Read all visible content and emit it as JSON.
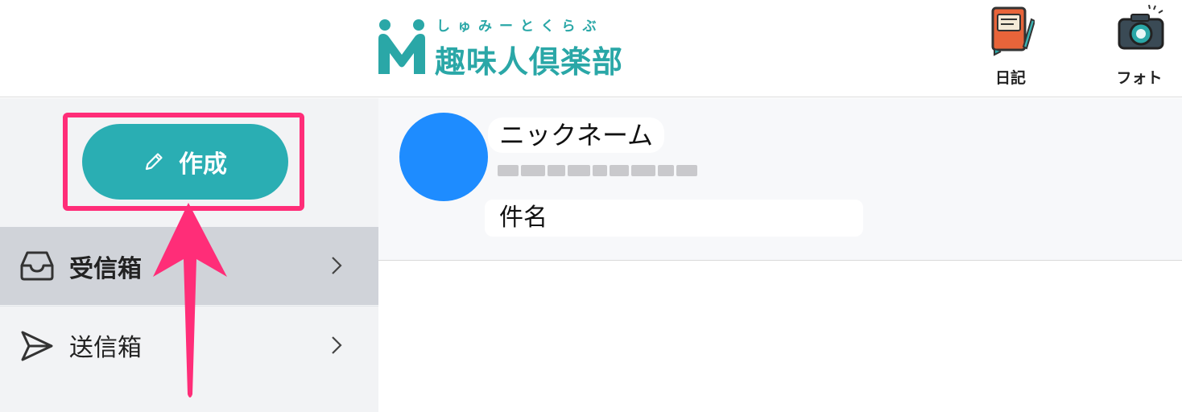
{
  "header": {
    "logo": {
      "kana": "しゅみーとくらぶ",
      "name": "趣味人倶楽部",
      "color": "#2aa7a7"
    },
    "buttons": [
      {
        "label": "日記",
        "icon": "diary-book-icon"
      },
      {
        "label": "フォト",
        "icon": "camera-icon"
      }
    ]
  },
  "sidebar": {
    "compose": {
      "label": "作成",
      "icon": "pencil-icon",
      "color": "#2aaeb3",
      "highlight_color": "#ff2d78"
    },
    "items": [
      {
        "label": "受信箱",
        "icon": "inbox-tray-icon",
        "selected": true
      },
      {
        "label": "送信箱",
        "icon": "send-plane-icon",
        "selected": false
      }
    ]
  },
  "messages": [
    {
      "nickname": "ニックネーム",
      "subject": "件名",
      "date_redacted": true,
      "avatar_color": "#1e8cff"
    }
  ],
  "annotation": {
    "type": "arrow-up",
    "color": "#ff2d78"
  }
}
